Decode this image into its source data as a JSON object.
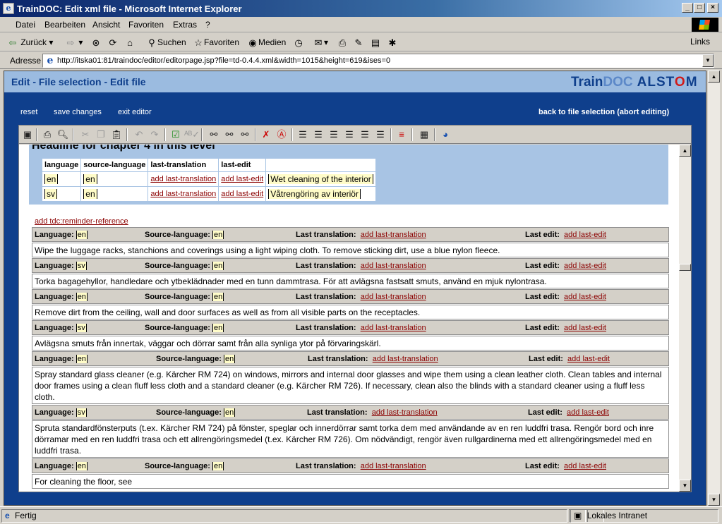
{
  "window": {
    "title": "TrainDOC: Edit xml file - Microsoft Internet Explorer"
  },
  "menu": [
    "Datei",
    "Bearbeiten",
    "Ansicht",
    "Favoriten",
    "Extras",
    "?"
  ],
  "toolbar": {
    "back": "Zurück",
    "search": "Suchen",
    "favorites": "Favoriten",
    "media": "Medien",
    "links": "Links"
  },
  "address": {
    "label": "Adresse",
    "url": "http://itska01:81/traindoc/editor/editorpage.jsp?file=td-0.4.4.xml&width=1015&height=619&ises=0"
  },
  "page": {
    "breadcrumb": "Edit - File selection - Edit file",
    "logo": {
      "train": "Train",
      "doc": "DOC",
      "alstom_a": "ALST",
      "alstom_o": "O",
      "alstom_m": "M"
    },
    "actions": {
      "reset": "reset",
      "save": "save changes",
      "exit": "exit editor",
      "back": "back to file selection (abort editing)"
    }
  },
  "chapter": {
    "headline": "Headline for chapter 4 in this level",
    "headers": [
      "language",
      "source-language",
      "last-translation",
      "last-edit"
    ],
    "rows": [
      {
        "lang": "en",
        "src": "en",
        "lt": "add last-translation",
        "le": "add last-edit",
        "text": "Wet cleaning of the interior"
      },
      {
        "lang": "sv",
        "src": "en",
        "lt": "add last-translation",
        "le": "add last-edit",
        "text": "Våtrengöring av interiör"
      }
    ]
  },
  "reminder_link": "add tdc:reminder-reference",
  "labels": {
    "language": "Language:",
    "source": "Source-language:",
    "last_translation": "Last translation:",
    "last_edit": "Last edit:",
    "add_lt": "add last-translation",
    "add_le": "add last-edit"
  },
  "entries": [
    {
      "lang": "en",
      "src": "en",
      "text": "Wipe the luggage racks, stanchions and coverings using a light wiping cloth. To remove sticking dirt, use a blue nylon fleece."
    },
    {
      "lang": "sv",
      "src": "en",
      "text": "Torka bagagehyllor, handledare och ytbeklädnader med en tunn dammtrasa. För att avlägsna fastsatt smuts, använd en mjuk nylontrasa."
    },
    {
      "lang": "en",
      "src": "en",
      "text": "Remove dirt from the ceiling, wall and door surfaces as well as from all visible parts on the receptacles."
    },
    {
      "lang": "sv",
      "src": "en",
      "text": "Avlägsna smuts från innertak, väggar och dörrar samt från alla synliga ytor på förvaringskärl."
    },
    {
      "lang": "en",
      "src": "en",
      "text": "Spray standard glass cleaner (e.g. Kärcher RM 724) on windows, mirrors and internal door glasses and wipe them using a clean leather cloth. Clean tables and internal door frames using a clean fluff less cloth and a standard cleaner (e.g. Kärcher RM 726). If necessary, clean also the blinds with a standard cleaner using a fluff less cloth."
    },
    {
      "lang": "sv",
      "src": "en",
      "text": "Spruta standardfönsterputs (t.ex. Kärcher RM 724) på fönster, speglar och innerdörrar samt torka dem med användande av en ren luddfri trasa. Rengör bord och inre dörramar med en ren luddfri trasa och ett allrengöringsmedel (t.ex. Kärcher RM 726). Om nödvändigt, rengör även rullgardinerna med ett allrengöringsmedel med en luddfri trasa."
    },
    {
      "lang": "en",
      "src": "en",
      "text": "For cleaning the floor, see"
    }
  ],
  "status": {
    "left": "Fertig",
    "zone": "Lokales Intranet"
  }
}
